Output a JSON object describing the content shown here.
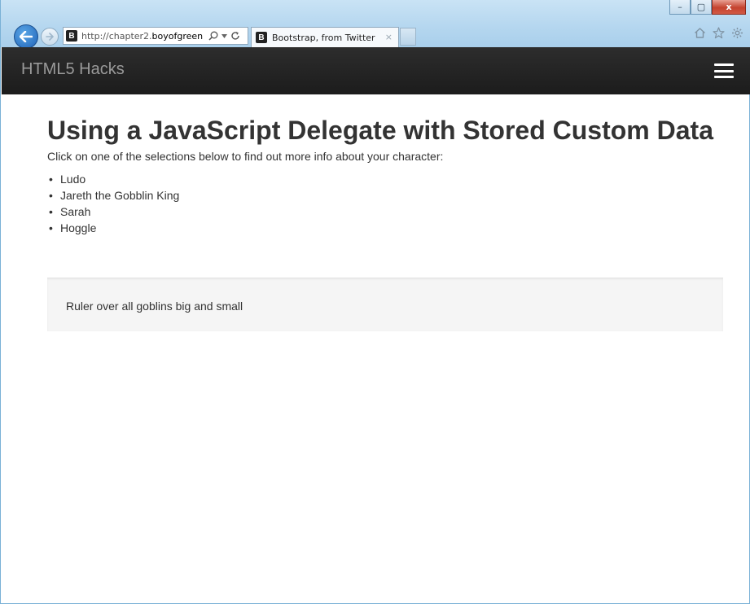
{
  "browser": {
    "address": {
      "prefix": "http://chapter2.",
      "domain": "boyofgreen.c...",
      "favicon_letter": "B"
    },
    "tab": {
      "title": "Bootstrap, from Twitter",
      "close": "×",
      "favicon_letter": "B"
    },
    "window_controls": [
      "–",
      "▢",
      "x"
    ]
  },
  "navbar": {
    "brand": "HTML5 Hacks"
  },
  "main": {
    "heading": "Using a JavaScript Delegate with Stored Custom Data",
    "intro": "Click on one of the selections below to find out more info about your character:",
    "characters": [
      "Ludo",
      "Jareth the Gobblin King",
      "Sarah",
      "Hoggle"
    ],
    "info": "Ruler over all goblins big and small"
  }
}
